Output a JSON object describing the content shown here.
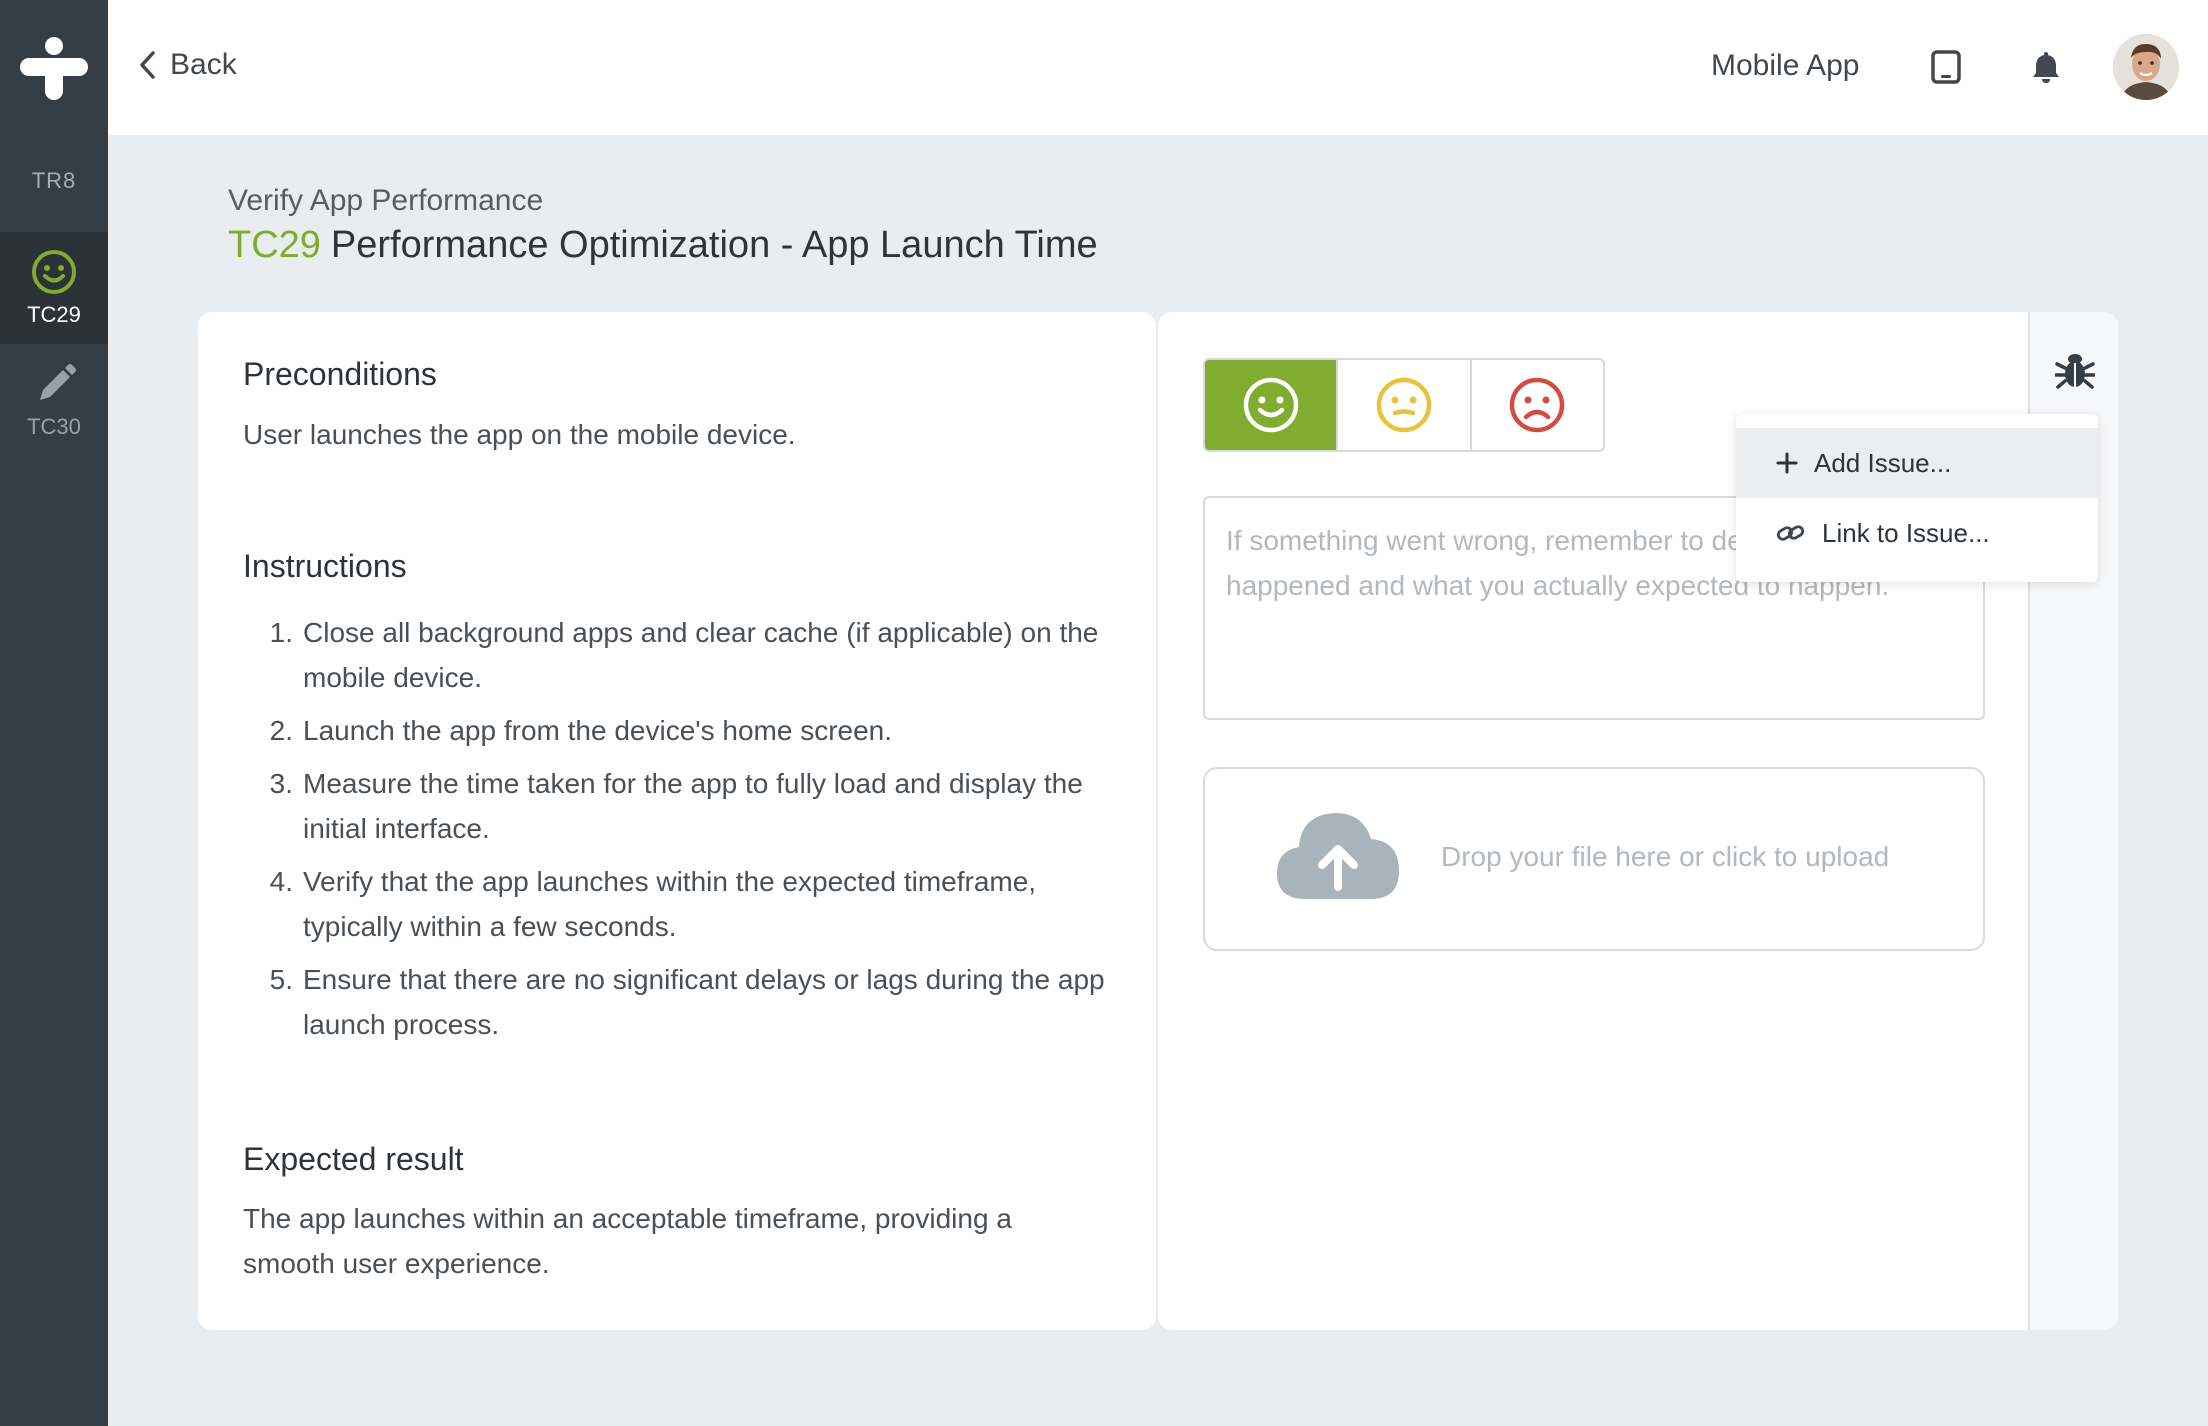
{
  "sidebar": {
    "run_label": "TR8",
    "items": [
      {
        "label": "TC29",
        "icon": "smile-icon",
        "active": true
      },
      {
        "label": "TC30",
        "icon": "pencil-icon",
        "active": false
      }
    ]
  },
  "header": {
    "back_label": "Back",
    "project_name": "Mobile App"
  },
  "test_case": {
    "suite": "Verify App Performance",
    "id": "TC29",
    "title": "Performance Optimization - App Launch Time",
    "preconditions_heading": "Preconditions",
    "preconditions": "User launches the app on the mobile device.",
    "instructions_heading": "Instructions",
    "instructions": [
      {
        "num": "1.",
        "text": "Close all background apps and clear cache (if applicable) on the mobile device."
      },
      {
        "num": "2.",
        "text": "Launch the app from the device's home screen."
      },
      {
        "num": "3.",
        "text": "Measure the time taken for the app to fully load and display the initial interface."
      },
      {
        "num": "4.",
        "text": "Verify that the app launches within the expected timeframe, typically within a few seconds."
      },
      {
        "num": "5.",
        "text": "Ensure that there are no significant delays or lags during the app launch process."
      }
    ],
    "expected_heading": "Expected result",
    "expected": "The app launches within an acceptable timeframe, providing a smooth user experience."
  },
  "result": {
    "options": [
      "pass",
      "blocked",
      "fail"
    ],
    "selected": "pass",
    "comment_value": "",
    "comment_placeholder": "If something went wrong, remember to describe what happened and what you actually expected to happen.",
    "upload_text": "Drop your file here or click to upload"
  },
  "issue_menu": {
    "add_issue": "Add Issue...",
    "link_issue": "Link to Issue..."
  },
  "colors": {
    "brand_green": "#80ad30",
    "neutral_yellow": "#e8c13d",
    "fail_red": "#d24d3f",
    "sidebar": "#363e45"
  }
}
